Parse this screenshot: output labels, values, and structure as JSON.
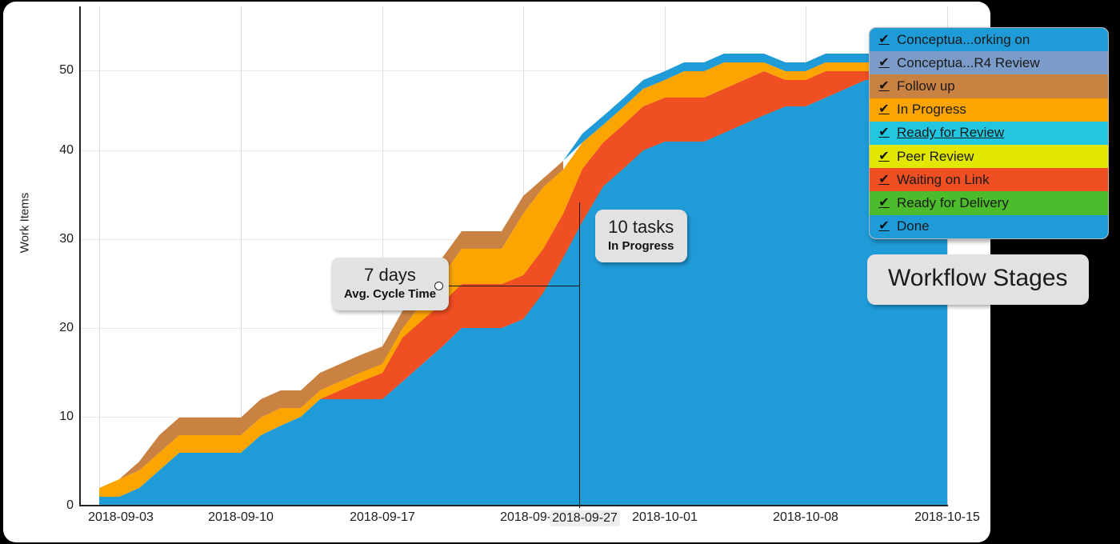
{
  "axes": {
    "ylabel": "Work Items",
    "yticks": [
      "0",
      "10",
      "20",
      "30",
      "40",
      "50"
    ],
    "xticks": [
      "2018-09-03",
      "2018-09-10",
      "2018-09-17",
      "2018-09-24",
      "2018-10-01",
      "2018-10-08",
      "2018-10-15"
    ],
    "cursor_xtick": "2018-09-27"
  },
  "annotations": {
    "cycle_time": {
      "value": "7 days",
      "label": "Avg. Cycle Time"
    },
    "tasks": {
      "value": "10 tasks",
      "label": "In Progress"
    },
    "stages_tooltip": "Workflow Stages"
  },
  "legend": {
    "check_glyph": "✔",
    "items": [
      {
        "label": "Conceptua...orking on",
        "color": "#1f9bd8",
        "underline": false
      },
      {
        "label": "Conceptua...R4 Review",
        "color": "#7b9bc9",
        "underline": false
      },
      {
        "label": "Follow up",
        "color": "#ca8243",
        "underline": false
      },
      {
        "label": "In Progress",
        "color": "#fca400",
        "underline": false
      },
      {
        "label": "Ready for Review",
        "color": "#23c6e0",
        "underline": true
      },
      {
        "label": "Peer Review",
        "color": "#e2e700",
        "underline": false
      },
      {
        "label": "Waiting on Link",
        "color": "#f04e23",
        "underline": false
      },
      {
        "label": "Ready for Delivery",
        "color": "#4cbb2c",
        "underline": false
      },
      {
        "label": "Done",
        "color": "#1f9bd8",
        "underline": false
      }
    ]
  },
  "chart_data": {
    "type": "area",
    "title": "",
    "xlabel": "",
    "ylabel": "Work Items",
    "ylim": [
      0,
      56
    ],
    "grid": true,
    "legend_position": "top-right",
    "stacked": true,
    "x": [
      "2018-09-03",
      "2018-09-04",
      "2018-09-05",
      "2018-09-06",
      "2018-09-07",
      "2018-09-08",
      "2018-09-09",
      "2018-09-10",
      "2018-09-11",
      "2018-09-12",
      "2018-09-13",
      "2018-09-14",
      "2018-09-15",
      "2018-09-16",
      "2018-09-17",
      "2018-09-18",
      "2018-09-19",
      "2018-09-20",
      "2018-09-21",
      "2018-09-22",
      "2018-09-23",
      "2018-09-24",
      "2018-09-25",
      "2018-09-26",
      "2018-09-27",
      "2018-09-28",
      "2018-09-29",
      "2018-09-30",
      "2018-10-01",
      "2018-10-02",
      "2018-10-03",
      "2018-10-04",
      "2018-10-05",
      "2018-10-06",
      "2018-10-07",
      "2018-10-08",
      "2018-10-09",
      "2018-10-10",
      "2018-10-11",
      "2018-10-12",
      "2018-10-13",
      "2018-10-14",
      "2018-10-15"
    ],
    "series": [
      {
        "name": "Done",
        "color": "#1f9bd8",
        "values": [
          0,
          0,
          1,
          3,
          5,
          5,
          5,
          5,
          7,
          8,
          10,
          12,
          12,
          12,
          12,
          14,
          16,
          18,
          20,
          20,
          20,
          21,
          24,
          28,
          32,
          36,
          38,
          40,
          41,
          41,
          41,
          42,
          43,
          44,
          45,
          46,
          46,
          47,
          48,
          49,
          49,
          49,
          49
        ]
      },
      {
        "name": "Ready for Delivery",
        "color": "#4cbb2c",
        "values": [
          0,
          0,
          0,
          0,
          0,
          0,
          0,
          0,
          0,
          0,
          0,
          0,
          0,
          0,
          0,
          0,
          0,
          0,
          0,
          0,
          0,
          1,
          1,
          1,
          2,
          1,
          1,
          1,
          1,
          1,
          1,
          1,
          1,
          1,
          0,
          0,
          0,
          0,
          0,
          0,
          0,
          0,
          0
        ]
      },
      {
        "name": "Waiting on Link",
        "color": "#f04e23",
        "values": [
          0,
          0,
          0,
          0,
          0,
          0,
          0,
          0,
          0,
          0,
          0,
          1,
          2,
          2,
          3,
          4,
          4,
          4,
          4,
          4,
          4,
          3,
          2,
          2,
          2,
          2,
          2,
          2,
          2,
          2,
          2,
          2,
          2,
          2,
          2,
          1,
          1,
          1,
          1,
          0,
          0,
          0,
          0
        ]
      },
      {
        "name": "Peer Review",
        "color": "#e2e700",
        "values": [
          0,
          0,
          0,
          0,
          0,
          0,
          0,
          0,
          0,
          0,
          0,
          0,
          0,
          0,
          1,
          1,
          1,
          1,
          0,
          0,
          0,
          0,
          0,
          0,
          0,
          0,
          0,
          0,
          0,
          0,
          0,
          0,
          0,
          0,
          0,
          0,
          0,
          0,
          0,
          0,
          0,
          0,
          0
        ]
      },
      {
        "name": "Ready for Review",
        "color": "#23c6e0",
        "values": [
          1,
          1,
          1,
          0,
          0,
          0,
          0,
          0,
          0,
          0,
          0,
          0,
          0,
          0,
          0,
          0,
          0,
          0,
          0,
          0,
          0,
          0,
          0,
          0,
          0,
          0,
          0,
          0,
          0,
          0,
          0,
          0,
          0,
          0,
          0,
          0,
          0,
          0,
          0,
          0,
          0,
          0,
          0
        ]
      },
      {
        "name": "In Progress",
        "color": "#fca400",
        "values": [
          0,
          1,
          1,
          2,
          2,
          2,
          2,
          2,
          2,
          2,
          2,
          1,
          1,
          1,
          1,
          2,
          3,
          3,
          4,
          4,
          4,
          6,
          6,
          4,
          2,
          2,
          2,
          2,
          2,
          3,
          3,
          3,
          2,
          2,
          2,
          1,
          1,
          1,
          1,
          1,
          1,
          1,
          1
        ]
      },
      {
        "name": "Follow up",
        "color": "#ca8243",
        "values": [
          0,
          0,
          1,
          1,
          1,
          1,
          1,
          1,
          1,
          1,
          1,
          1,
          1,
          1,
          1,
          1,
          1,
          1,
          1,
          1,
          1,
          1,
          1,
          1,
          0,
          0,
          0,
          0,
          0,
          0,
          0,
          0,
          0,
          0,
          0,
          0,
          0,
          0,
          0,
          0,
          0,
          0,
          0
        ]
      },
      {
        "name": "Conceptua...R4 Review",
        "color": "#7b9bc9",
        "values": [
          0,
          0,
          0,
          0,
          0,
          0,
          0,
          0,
          0,
          0,
          0,
          0,
          0,
          0,
          0,
          0,
          0,
          0,
          0,
          0,
          0,
          0,
          0,
          0,
          0,
          0,
          0,
          0,
          0,
          0,
          0,
          0,
          0,
          0,
          0,
          0,
          0,
          0,
          0,
          0,
          0,
          0,
          0
        ]
      },
      {
        "name": "Conceptua...orking on",
        "color": "#1f9bd8",
        "values": [
          0,
          0,
          0,
          0,
          0,
          0,
          0,
          1,
          1,
          1,
          1,
          1,
          1,
          1,
          1,
          1,
          1,
          1,
          1,
          1,
          1,
          1,
          1,
          1,
          1,
          1,
          1,
          1,
          1,
          1,
          1,
          1,
          1,
          1,
          1,
          1,
          1,
          1,
          1,
          1,
          1,
          1,
          1
        ]
      }
    ]
  }
}
